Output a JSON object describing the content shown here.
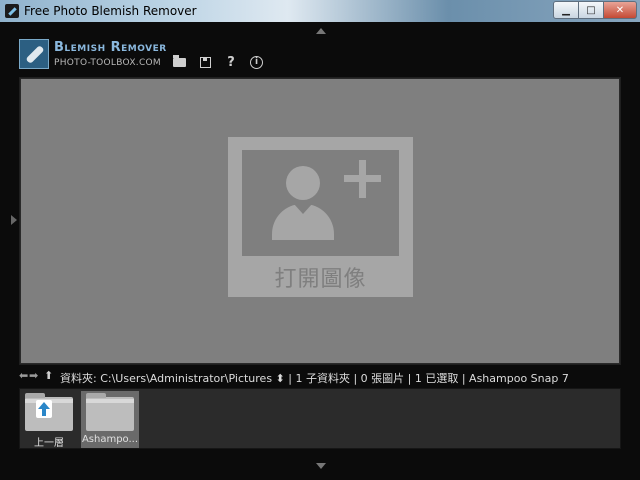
{
  "window": {
    "title": "Free Photo Blemish Remover",
    "minimize_glyph": "▁",
    "maximize_glyph": "□",
    "close_glyph": "✕"
  },
  "brand": {
    "name": "Blemish Remover",
    "site": "PHOTO-TOOLBOX.COM",
    "accent": "#8ab8de"
  },
  "toolbar": {
    "open_icon": "folder-open-icon",
    "save_icon": "save-icon",
    "help_glyph": "?",
    "info_glyph": "i"
  },
  "canvas": {
    "placeholder_label": "打開圖像",
    "background": "#7f7f7f"
  },
  "pathbar": {
    "back_glyph": "⬅",
    "forward_glyph": "➡",
    "up_glyph": "⬆",
    "text": "資料夾: C:\\Users\\Administrator\\Pictures ⬍ | 1 子資料夾 | 0 張圖片 | 1 已選取 | Ashampoo Snap 7"
  },
  "browser": {
    "items": [
      {
        "label": "上一層",
        "icon": "folder-up-icon",
        "selected": false
      },
      {
        "label": "Ashampo...",
        "icon": "folder-icon",
        "selected": true
      }
    ]
  }
}
